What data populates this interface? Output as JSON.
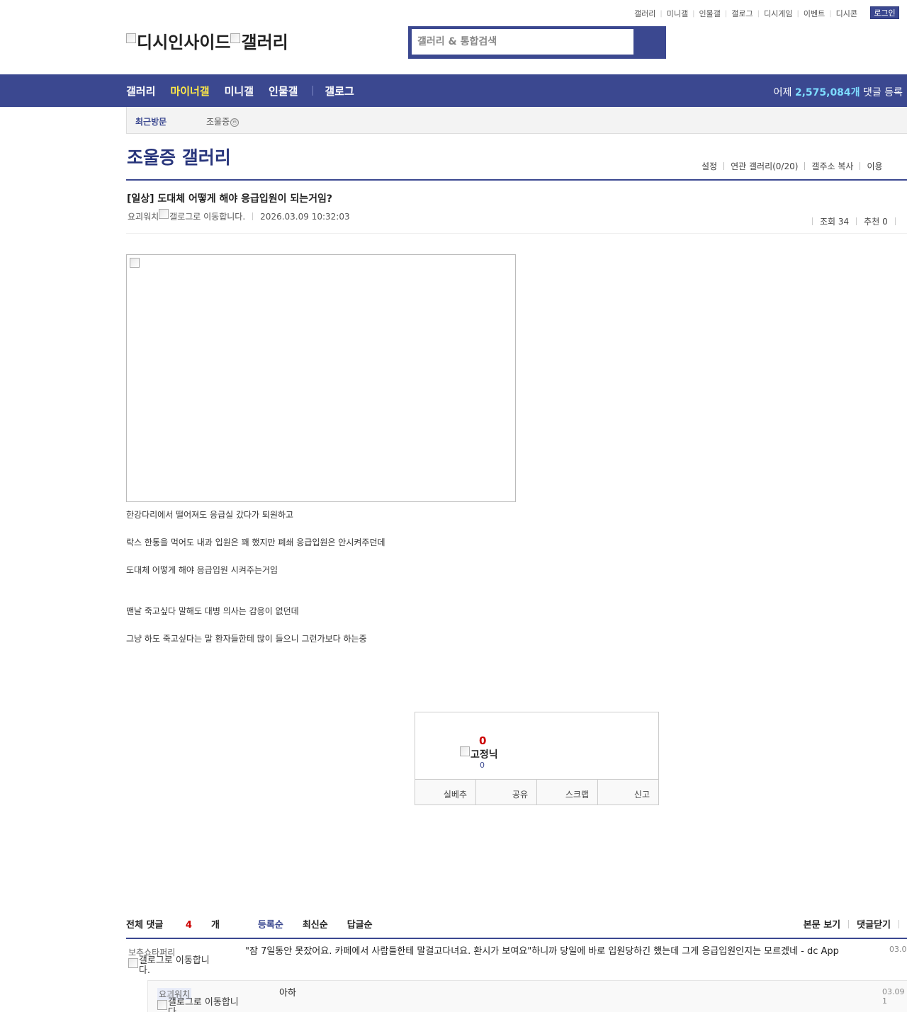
{
  "top_links": [
    "갤러리",
    "미니갤",
    "인물갤",
    "갤로그",
    "디시게임",
    "이벤트",
    "디시콘"
  ],
  "login_label": "로그인",
  "logo": {
    "site_alt": "디시인사이드",
    "gallery_alt": "갤러리"
  },
  "search": {
    "placeholder": "갤러리 & 통합검색"
  },
  "gnb": {
    "items": [
      "갤러리",
      "마이너갤",
      "미니갤",
      "인물갤",
      "갤로그"
    ],
    "active": "마이너갤",
    "stat_prefix": "어제",
    "stat_value": "2,575,084개",
    "stat_suffix": "댓글 등록"
  },
  "recent": {
    "label": "최근방문",
    "item": "조울증",
    "badge": "ⓜ"
  },
  "gallery": {
    "title": "조울증 갤러리",
    "tools": [
      "설정",
      "연관 갤러리(0/20)",
      "갤주소 복사",
      "이용"
    ]
  },
  "post": {
    "title": "[일상] 도대체 어떻게 해야 응급입원이 되는거임?",
    "author": "요괴워치",
    "gallog_alt": "갤로그로 이동합니다.",
    "datetime": "2026.03.09 10:32:03",
    "views_label": "조회 34",
    "recommend_label": "추천 0",
    "body": [
      "한강다리에서 떨어져도 응급실 갔다가 퇴원하고",
      "락스 한통을 먹어도 내과 입원은 꽤 했지만 폐쇄 응급입원은 안시켜주던데",
      "도대체 어떻게 해야 응급입원 시켜주는거임",
      "맨날 죽고싶다 말해도 대병 의사는 감응이 없던데",
      "그냥 하도 죽고싶다는 말 환자들한테 많이 들으니 그런가보다 하는중"
    ]
  },
  "recommend_box": {
    "count": "0",
    "fixnick_alt": "고정닉",
    "fixnick_count": "0",
    "buttons": [
      "실베추",
      "공유",
      "스크랩",
      "신고"
    ]
  },
  "comments_header": {
    "total_prefix": "전체 댓글",
    "total_count": "4",
    "total_suffix": "개",
    "sorts": [
      "등록순",
      "최신순",
      "답글순"
    ],
    "active_sort": "등록순",
    "right": [
      "본문 보기",
      "댓글닫기"
    ]
  },
  "comments": [
    {
      "nick": "보추쇼타퍼리",
      "gallog_alt": "갤로그로 이동합니다.",
      "text": "\"잠 7일동안 못잤어요. 카페에서 사람들한테 말걸고다녀요. 환시가 보여요\"하니까 당일에 바로 입원당하긴 했는데 그게 응급입원인지는 모르겠네 - dc App",
      "date": "03.0"
    },
    {
      "nick": "요괴워치",
      "gallog_alt": "갤로그로 이동합니다.",
      "text": "아하",
      "date": "03.09 1"
    }
  ]
}
